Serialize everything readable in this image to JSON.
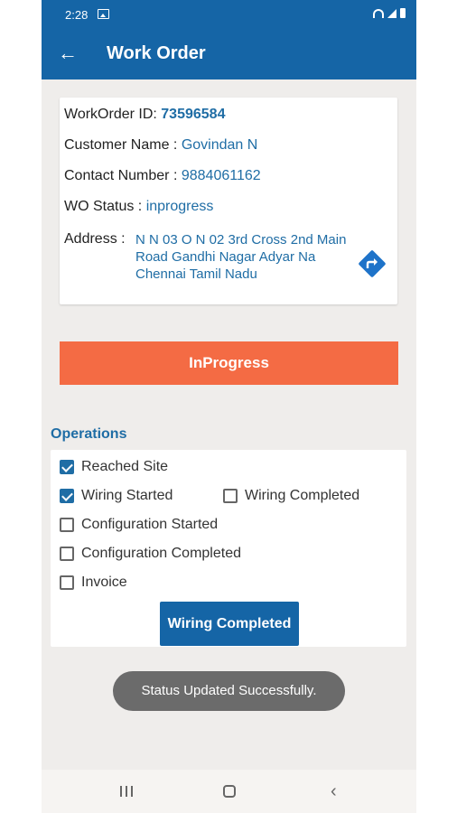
{
  "status_bar": {
    "time": "2:28"
  },
  "app_bar": {
    "title": "Work Order",
    "back_icon": "arrow-left-icon"
  },
  "details": {
    "work_order_label": "WorkOrder ID:",
    "work_order_id": "73596584",
    "customer_label": "Customer Name :",
    "customer_name": "Govindan N",
    "contact_label": "Contact Number :",
    "contact_number": "9884061162",
    "status_label": "WO Status :",
    "status_value": "inprogress",
    "address_label": "Address :",
    "address_value": "N N 03 O N 02 3rd Cross 2nd Main Road Gandhi Nagar Adyar Na Chennai Tamil Nadu",
    "directions_icon": "directions-icon"
  },
  "progress_button": {
    "label": "InProgress",
    "color": "#f46b44"
  },
  "operations": {
    "title": "Operations",
    "items": [
      {
        "label": "Reached Site",
        "checked": true
      },
      {
        "label": "Wiring Started",
        "checked": true
      },
      {
        "label": "Wiring Completed",
        "checked": false
      },
      {
        "label": "Configuration Started",
        "checked": false
      },
      {
        "label": "Configuration Completed",
        "checked": false
      },
      {
        "label": "Invoice",
        "checked": false
      }
    ],
    "action_button": "Wiring Completed"
  },
  "toast": {
    "message": "Status Updated Successfully."
  },
  "colors": {
    "primary": "#1565a6",
    "accent": "#f46b44",
    "link": "#1f6da5"
  }
}
